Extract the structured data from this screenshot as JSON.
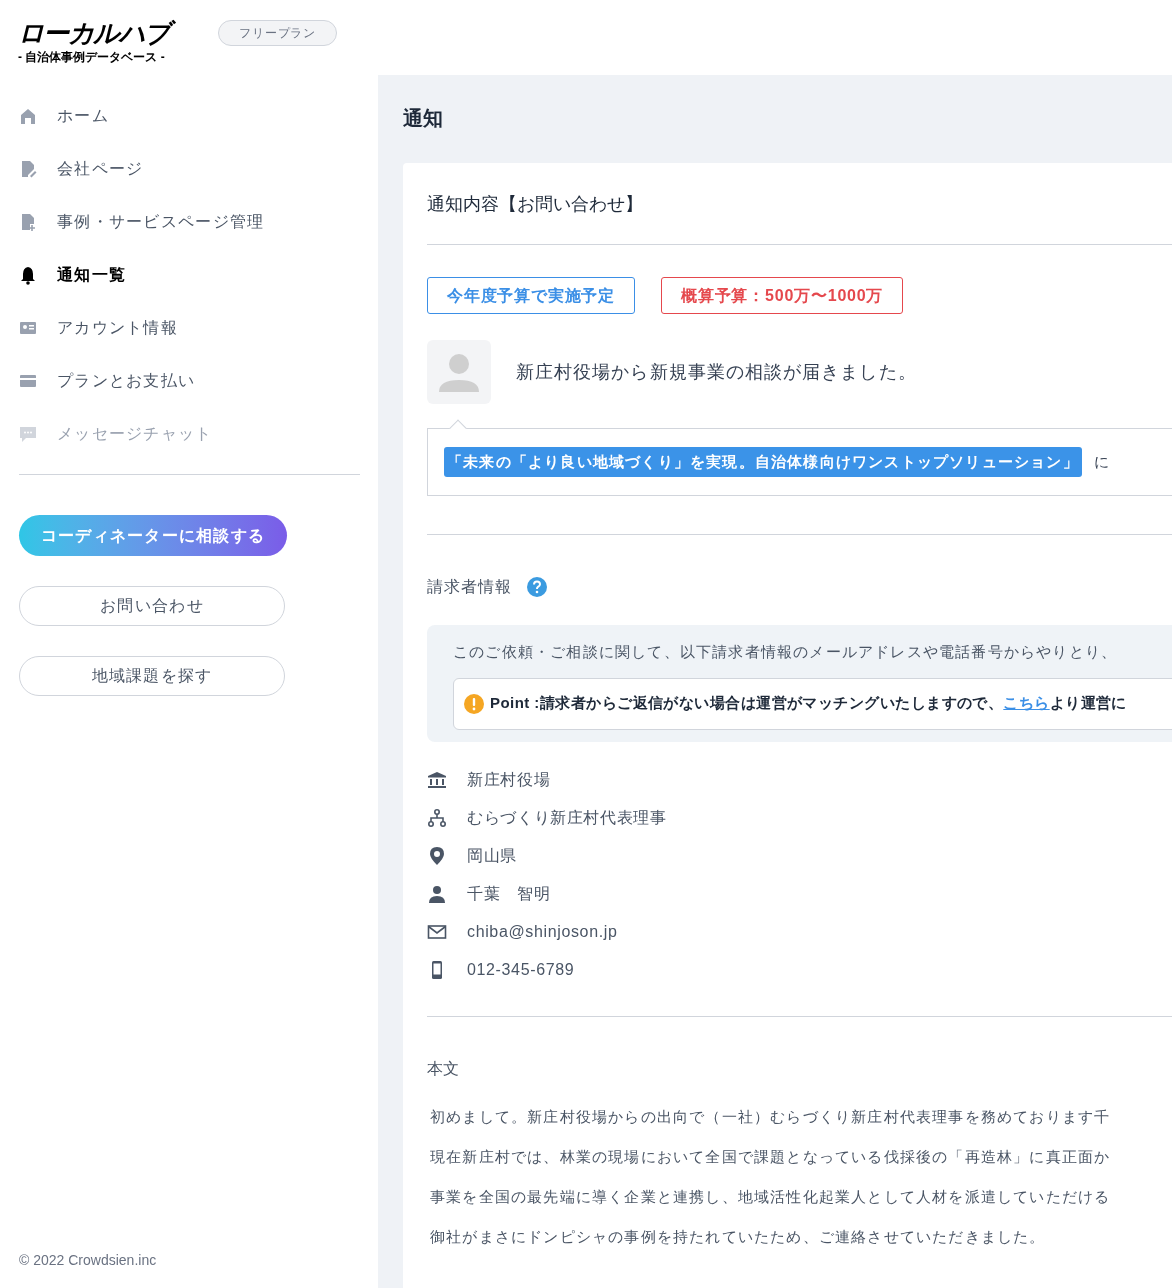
{
  "logo": {
    "title": "ローカルハブ",
    "subtitle": "- 自治体事例データベース -"
  },
  "plan_badge": "フリープラン",
  "sidebar": {
    "items": [
      {
        "kind": "home",
        "label": "ホーム",
        "selected": false,
        "disabled": false
      },
      {
        "kind": "page",
        "label": "会社ページ",
        "selected": false,
        "disabled": false
      },
      {
        "kind": "document",
        "label": "事例・サービスページ管理",
        "selected": false,
        "disabled": false
      },
      {
        "kind": "bell",
        "label": "通知一覧",
        "selected": true,
        "disabled": false
      },
      {
        "kind": "account",
        "label": "アカウント情報",
        "selected": false,
        "disabled": false
      },
      {
        "kind": "card",
        "label": "プランとお支払い",
        "selected": false,
        "disabled": false
      },
      {
        "kind": "chat",
        "label": "メッセージチャット",
        "selected": false,
        "disabled": true
      }
    ],
    "primary_button": "コーディネーターに相談する",
    "buttons": [
      "お問い合わせ",
      "地域課題を探す"
    ],
    "footer": "© 2022 Crowdsien.inc"
  },
  "page_title": "通知",
  "notification": {
    "heading": "通知内容【お問い合わせ】",
    "tags": [
      {
        "label": "今年度予算で実施予定",
        "color": "#3b8fe6"
      },
      {
        "label": "概算予算：500万〜1000万",
        "color": "#e5484d"
      }
    ],
    "message": "新庄村役場から新規事業の相談が届きました。",
    "quote": {
      "title": "「未来の「より良い地域づくり」を実現。自治体様向けワンストップソリューション」",
      "suffix": "に"
    },
    "requester": {
      "heading": "請求者情報",
      "note": "このご依頼・ご相談に関して、以下請求者情報のメールアドレスや電話番号からやりとり、",
      "point": {
        "label": "Point :",
        "text_before": "請求者からご返信がない場合は運営がマッチングいたしますので、",
        "link": "こちら",
        "text_after": "より運営に"
      },
      "details": [
        {
          "kind": "organization",
          "text": "新庄村役場"
        },
        {
          "kind": "department",
          "text": "むらづくり新庄村代表理事"
        },
        {
          "kind": "location",
          "text": "岡山県"
        },
        {
          "kind": "person",
          "text": "千葉　智明"
        },
        {
          "kind": "email",
          "text": "chiba@shinjoson.jp"
        },
        {
          "kind": "phone",
          "text": "012-345-6789"
        }
      ]
    },
    "body": {
      "heading": "本文",
      "lines": [
        "初めまして。新庄村役場からの出向で（一社）むらづくり新庄村代表理事を務めております千",
        "現在新庄村では、林業の現場において全国で課題となっている伐採後の「再造林」に真正面か",
        "事業を全国の最先端に導く企業と連携し、地域活性化起業人として人材を派遣していただける",
        "御社がまさにドンピシャの事例を持たれていたため、ご連絡させていただきました。"
      ]
    }
  }
}
